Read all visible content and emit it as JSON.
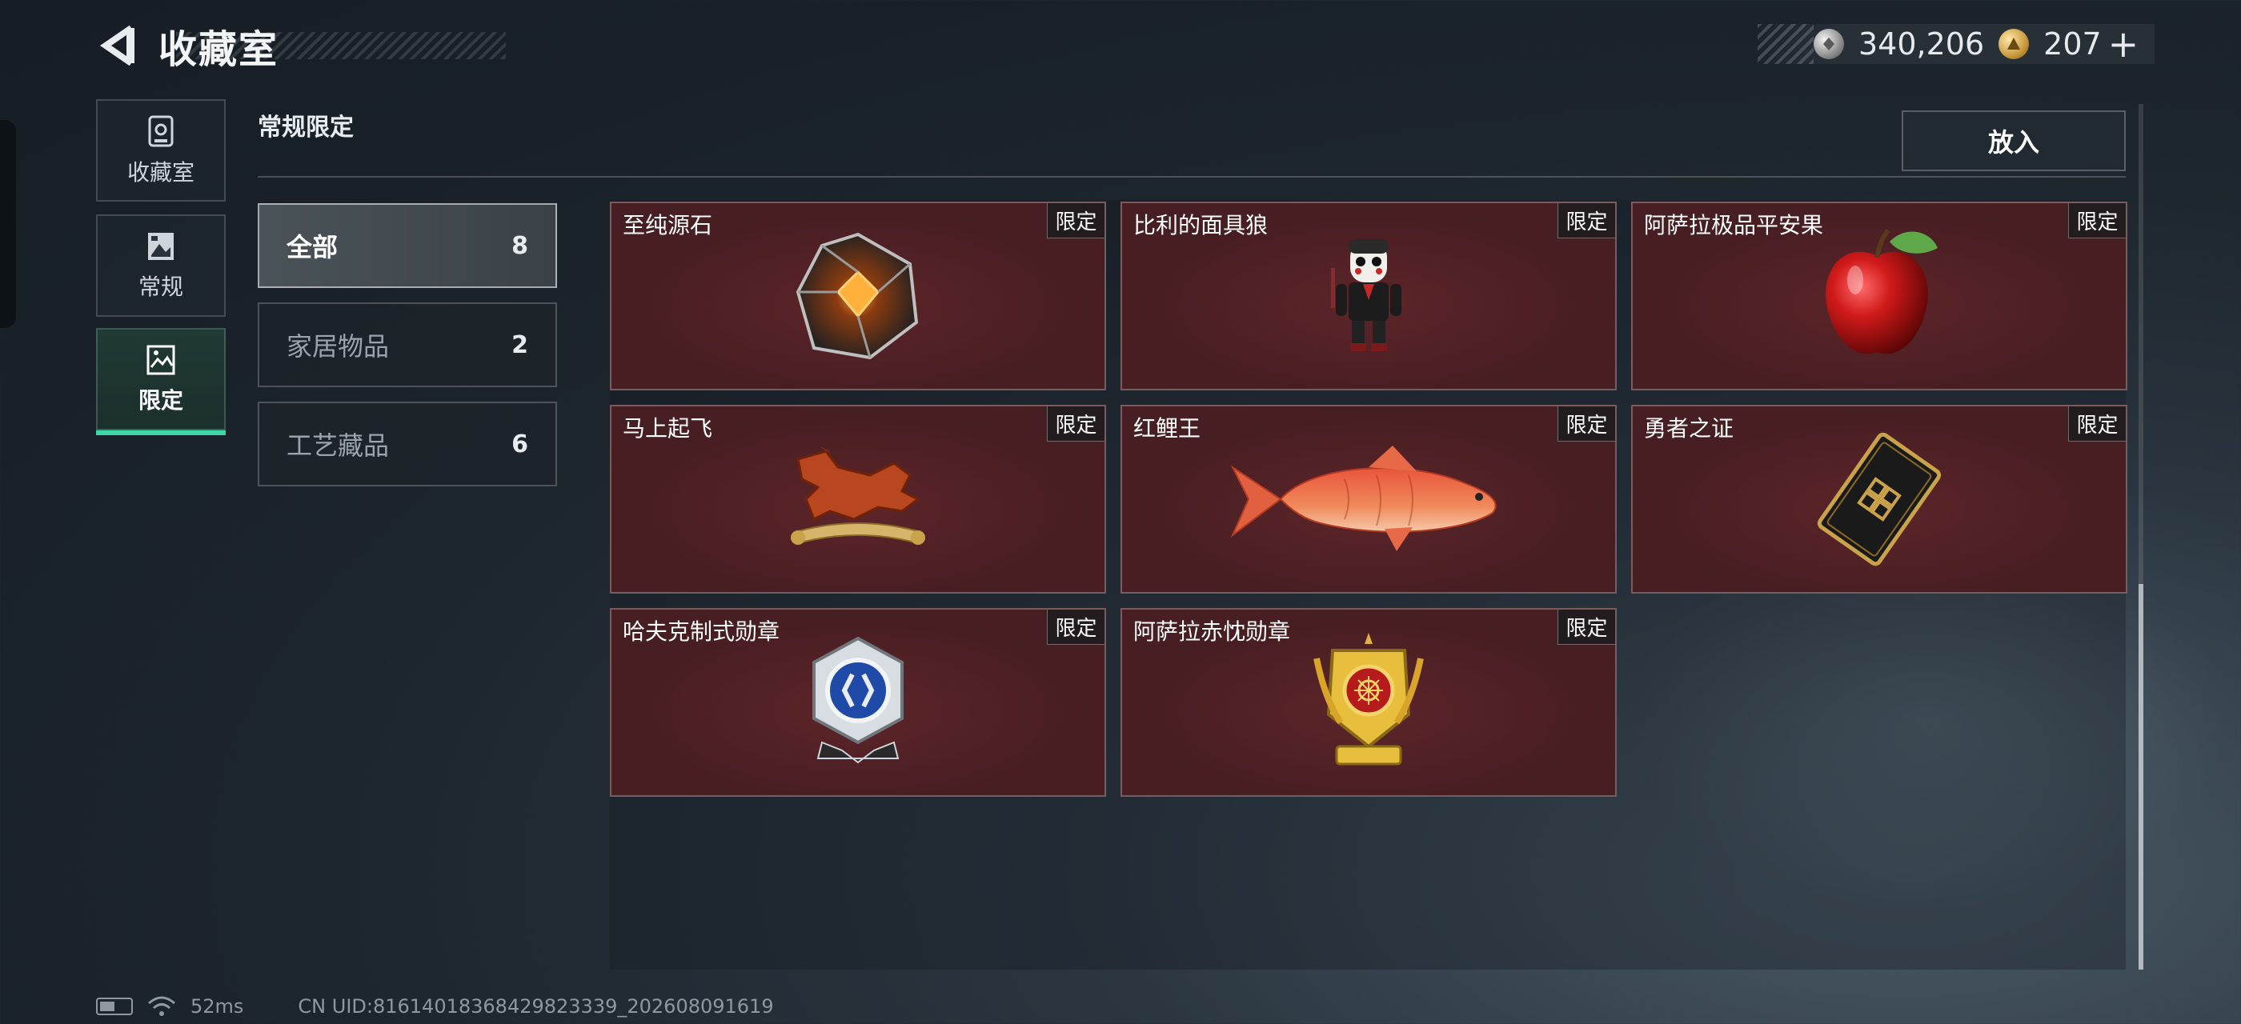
{
  "header": {
    "back_icon": "back-arrow-icon",
    "title": "收藏室"
  },
  "currency": {
    "silver_icon": "silver-coin-icon",
    "silver_value": "340,206",
    "gold_icon": "gold-coin-icon",
    "gold_value": "207",
    "add_label": "+"
  },
  "sidebar": {
    "tabs": [
      {
        "label": "收藏室",
        "icon": "collection-room-icon",
        "active": false
      },
      {
        "label": "常规",
        "icon": "regular-picture-icon",
        "active": false
      },
      {
        "label": "限定",
        "icon": "limited-picture-icon",
        "active": true
      }
    ]
  },
  "section": {
    "title": "常规限定",
    "put_button": "放入"
  },
  "categories": [
    {
      "label": "全部",
      "count": "8",
      "active": true
    },
    {
      "label": "家居物品",
      "count": "2",
      "active": false
    },
    {
      "label": "工艺藏品",
      "count": "6",
      "active": false
    }
  ],
  "items": [
    {
      "name": "至纯源石",
      "badge": "限定",
      "icon": "source-stone-icon"
    },
    {
      "name": "比利的面具狼",
      "badge": "限定",
      "icon": "puppet-figure-icon"
    },
    {
      "name": "阿萨拉极品平安果",
      "badge": "限定",
      "icon": "apple-icon"
    },
    {
      "name": "马上起飞",
      "badge": "限定",
      "icon": "horse-statue-icon"
    },
    {
      "name": "红鲤王",
      "badge": "限定",
      "icon": "carp-fish-icon"
    },
    {
      "name": "勇者之证",
      "badge": "限定",
      "icon": "card-token-icon"
    },
    {
      "name": "哈夫克制式勋章",
      "badge": "限定",
      "icon": "silver-medal-icon"
    },
    {
      "name": "阿萨拉赤忱勋章",
      "badge": "限定",
      "icon": "gold-medal-icon"
    }
  ],
  "footer": {
    "battery_icon": "battery-icon",
    "wifi_icon": "wifi-icon",
    "ping": "52ms",
    "uid": "CN UID:8161401836842982333​9_202608091619"
  },
  "colors": {
    "accent": "#3fd6a8",
    "card_bg": "#471e22"
  }
}
